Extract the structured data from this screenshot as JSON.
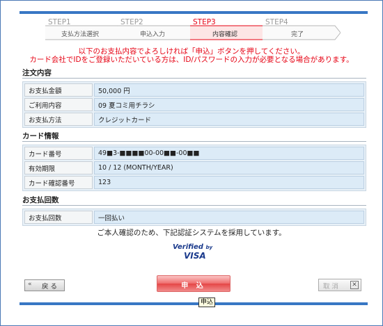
{
  "steps": [
    {
      "num": "STEP1",
      "label": "支払方法選択",
      "active": false
    },
    {
      "num": "STEP2",
      "label": "申込入力",
      "active": false
    },
    {
      "num": "STEP3",
      "label": "内容確認",
      "active": true
    },
    {
      "num": "STEP4",
      "label": "完了",
      "active": false
    }
  ],
  "notice": {
    "line1": "以下のお支払内容でよろしければ「申込」ボタンを押してください。",
    "line2": "カード会社でIDをご登録いただいている方は、ID/パスワードの入力が必要となる場合があります。"
  },
  "order": {
    "title": "注文内容",
    "rows": [
      {
        "key": "お支払金額",
        "value": "50,000 円"
      },
      {
        "key": "ご利用内容",
        "value": "09 夏コミ用チラシ"
      },
      {
        "key": "お支払方法",
        "value": "クレジットカード"
      }
    ]
  },
  "card": {
    "title": "カード情報",
    "rows": [
      {
        "key": "カード番号",
        "value": "49■3-■■■■00-00■■-00■■"
      },
      {
        "key": "有効期限",
        "value": "10 / 12 (MONTH/YEAR)"
      },
      {
        "key": "カード確認番号",
        "value": "123"
      }
    ]
  },
  "installments": {
    "title": "お支払回数",
    "rows": [
      {
        "key": "お支払回数",
        "value": "一回払い"
      }
    ]
  },
  "confirm_note": "ご本人確認のため、下記認証システムを採用しています。",
  "verified": {
    "line1": "Verified",
    "by": "by",
    "line2": "VISA"
  },
  "buttons": {
    "back_icon": "«",
    "back": "戻 る",
    "submit": "申 込",
    "cancel": "取 消",
    "cancel_icon": "✕"
  },
  "tooltip": "申込",
  "colors": {
    "accent": "#3877c4",
    "alert": "#e60012"
  }
}
